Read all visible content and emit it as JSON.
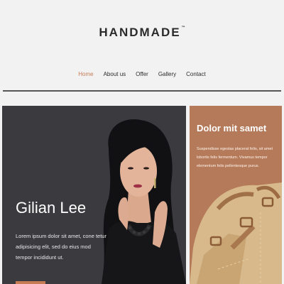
{
  "header": {
    "logo_text": "HANDMADE",
    "logo_mark": "™",
    "nav": [
      "Home",
      "About us",
      "Offer",
      "Gallery",
      "Contact"
    ],
    "active_nav": "Home"
  },
  "hero": {
    "title": "Gilian Lee",
    "text": "Lorem ipsum dolor sit amet, cone tetur adipisicing elit, sed do eius mod tempor incididunt ut."
  },
  "promo": {
    "title": "Dolor mit samet",
    "text": "Suspendisse egestas placerat felis, sit amet lobortis felis fermentum. Vivamus tempor elementum felis pellentesque purus."
  },
  "colors": {
    "accent": "#c77c56",
    "promo_bg": "#b47a5a",
    "hero_bg": "#3a3a3f",
    "page_bg": "#f2f2f2"
  }
}
